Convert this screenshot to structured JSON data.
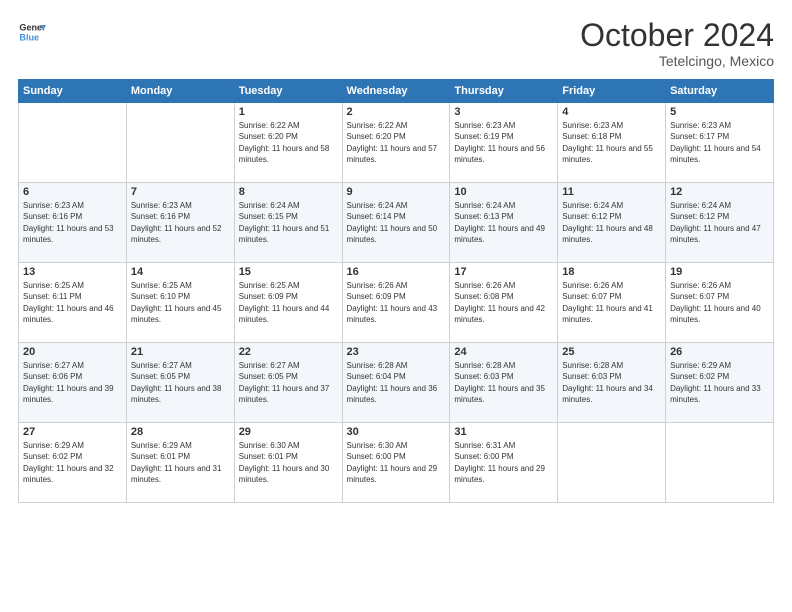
{
  "header": {
    "logo_line1": "General",
    "logo_line2": "Blue",
    "month": "October 2024",
    "location": "Tetelcingo, Mexico"
  },
  "days_of_week": [
    "Sunday",
    "Monday",
    "Tuesday",
    "Wednesday",
    "Thursday",
    "Friday",
    "Saturday"
  ],
  "weeks": [
    [
      {
        "day": "",
        "info": ""
      },
      {
        "day": "",
        "info": ""
      },
      {
        "day": "1",
        "info": "Sunrise: 6:22 AM\nSunset: 6:20 PM\nDaylight: 11 hours and 58 minutes."
      },
      {
        "day": "2",
        "info": "Sunrise: 6:22 AM\nSunset: 6:20 PM\nDaylight: 11 hours and 57 minutes."
      },
      {
        "day": "3",
        "info": "Sunrise: 6:23 AM\nSunset: 6:19 PM\nDaylight: 11 hours and 56 minutes."
      },
      {
        "day": "4",
        "info": "Sunrise: 6:23 AM\nSunset: 6:18 PM\nDaylight: 11 hours and 55 minutes."
      },
      {
        "day": "5",
        "info": "Sunrise: 6:23 AM\nSunset: 6:17 PM\nDaylight: 11 hours and 54 minutes."
      }
    ],
    [
      {
        "day": "6",
        "info": "Sunrise: 6:23 AM\nSunset: 6:16 PM\nDaylight: 11 hours and 53 minutes."
      },
      {
        "day": "7",
        "info": "Sunrise: 6:23 AM\nSunset: 6:16 PM\nDaylight: 11 hours and 52 minutes."
      },
      {
        "day": "8",
        "info": "Sunrise: 6:24 AM\nSunset: 6:15 PM\nDaylight: 11 hours and 51 minutes."
      },
      {
        "day": "9",
        "info": "Sunrise: 6:24 AM\nSunset: 6:14 PM\nDaylight: 11 hours and 50 minutes."
      },
      {
        "day": "10",
        "info": "Sunrise: 6:24 AM\nSunset: 6:13 PM\nDaylight: 11 hours and 49 minutes."
      },
      {
        "day": "11",
        "info": "Sunrise: 6:24 AM\nSunset: 6:12 PM\nDaylight: 11 hours and 48 minutes."
      },
      {
        "day": "12",
        "info": "Sunrise: 6:24 AM\nSunset: 6:12 PM\nDaylight: 11 hours and 47 minutes."
      }
    ],
    [
      {
        "day": "13",
        "info": "Sunrise: 6:25 AM\nSunset: 6:11 PM\nDaylight: 11 hours and 46 minutes."
      },
      {
        "day": "14",
        "info": "Sunrise: 6:25 AM\nSunset: 6:10 PM\nDaylight: 11 hours and 45 minutes."
      },
      {
        "day": "15",
        "info": "Sunrise: 6:25 AM\nSunset: 6:09 PM\nDaylight: 11 hours and 44 minutes."
      },
      {
        "day": "16",
        "info": "Sunrise: 6:26 AM\nSunset: 6:09 PM\nDaylight: 11 hours and 43 minutes."
      },
      {
        "day": "17",
        "info": "Sunrise: 6:26 AM\nSunset: 6:08 PM\nDaylight: 11 hours and 42 minutes."
      },
      {
        "day": "18",
        "info": "Sunrise: 6:26 AM\nSunset: 6:07 PM\nDaylight: 11 hours and 41 minutes."
      },
      {
        "day": "19",
        "info": "Sunrise: 6:26 AM\nSunset: 6:07 PM\nDaylight: 11 hours and 40 minutes."
      }
    ],
    [
      {
        "day": "20",
        "info": "Sunrise: 6:27 AM\nSunset: 6:06 PM\nDaylight: 11 hours and 39 minutes."
      },
      {
        "day": "21",
        "info": "Sunrise: 6:27 AM\nSunset: 6:05 PM\nDaylight: 11 hours and 38 minutes."
      },
      {
        "day": "22",
        "info": "Sunrise: 6:27 AM\nSunset: 6:05 PM\nDaylight: 11 hours and 37 minutes."
      },
      {
        "day": "23",
        "info": "Sunrise: 6:28 AM\nSunset: 6:04 PM\nDaylight: 11 hours and 36 minutes."
      },
      {
        "day": "24",
        "info": "Sunrise: 6:28 AM\nSunset: 6:03 PM\nDaylight: 11 hours and 35 minutes."
      },
      {
        "day": "25",
        "info": "Sunrise: 6:28 AM\nSunset: 6:03 PM\nDaylight: 11 hours and 34 minutes."
      },
      {
        "day": "26",
        "info": "Sunrise: 6:29 AM\nSunset: 6:02 PM\nDaylight: 11 hours and 33 minutes."
      }
    ],
    [
      {
        "day": "27",
        "info": "Sunrise: 6:29 AM\nSunset: 6:02 PM\nDaylight: 11 hours and 32 minutes."
      },
      {
        "day": "28",
        "info": "Sunrise: 6:29 AM\nSunset: 6:01 PM\nDaylight: 11 hours and 31 minutes."
      },
      {
        "day": "29",
        "info": "Sunrise: 6:30 AM\nSunset: 6:01 PM\nDaylight: 11 hours and 30 minutes."
      },
      {
        "day": "30",
        "info": "Sunrise: 6:30 AM\nSunset: 6:00 PM\nDaylight: 11 hours and 29 minutes."
      },
      {
        "day": "31",
        "info": "Sunrise: 6:31 AM\nSunset: 6:00 PM\nDaylight: 11 hours and 29 minutes."
      },
      {
        "day": "",
        "info": ""
      },
      {
        "day": "",
        "info": ""
      }
    ]
  ]
}
